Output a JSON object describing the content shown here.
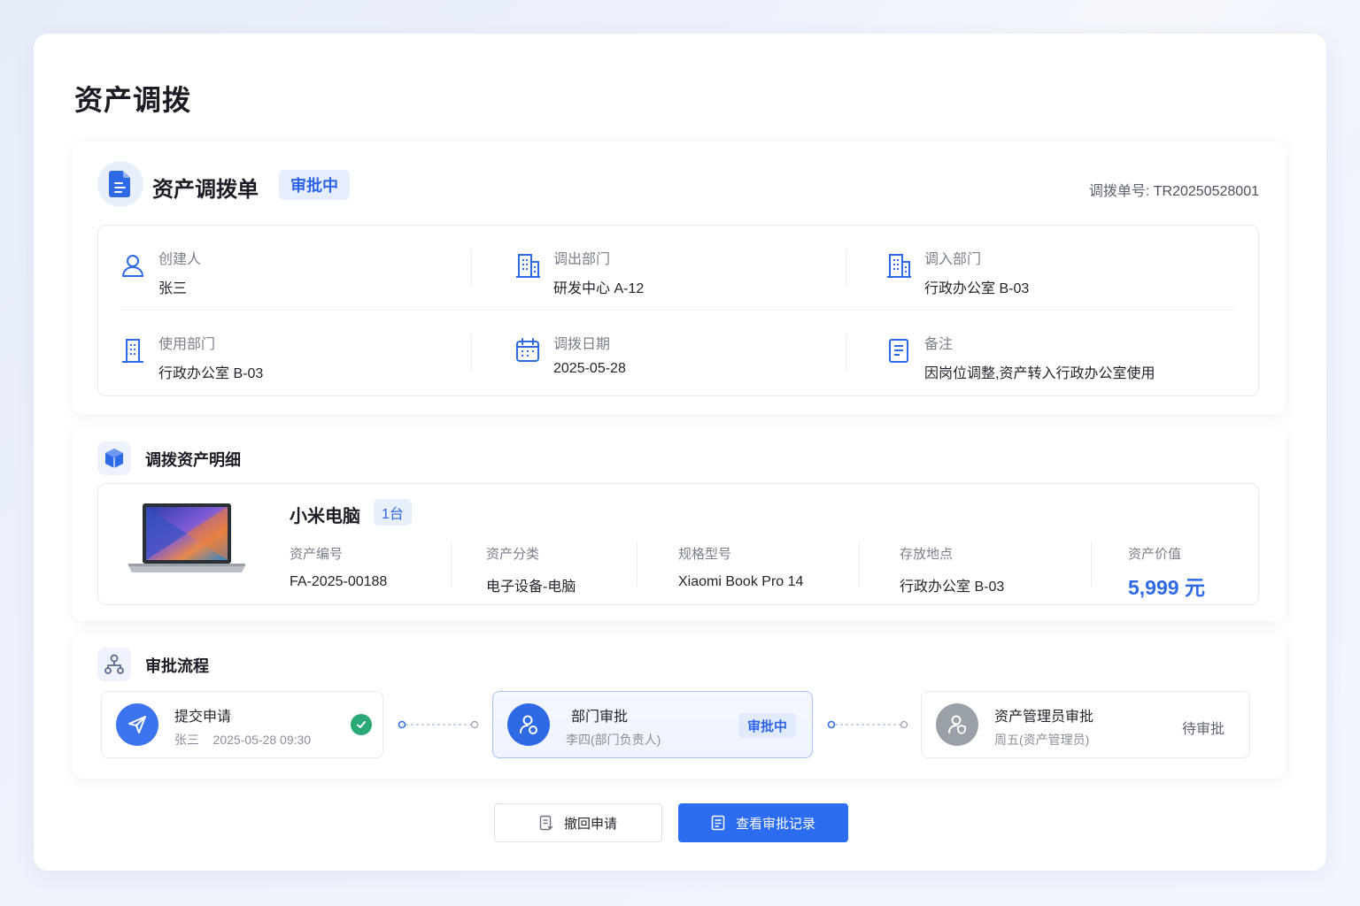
{
  "page": {
    "title": "资产调拨"
  },
  "form": {
    "title": "资产调拨单",
    "status": "审批中",
    "order_no_label": "调拨单号:",
    "order_no": "TR20250528001",
    "fields": [
      {
        "label": "创建人",
        "value": "张三",
        "icon": "user-icon"
      },
      {
        "label": "调出部门",
        "value": "研发中心 A-12",
        "icon": "building-icon"
      },
      {
        "label": "调入部门",
        "value": "行政办公室 B-03",
        "icon": "building-icon"
      },
      {
        "label": "使用部门",
        "value": "行政办公室 B-03",
        "icon": "building-icon"
      },
      {
        "label": "调拨日期",
        "value": "2025-05-28",
        "icon": "calendar-icon"
      },
      {
        "label": "备注",
        "value": "因岗位调整,资产转入行政办公室使用",
        "icon": "note-icon"
      }
    ]
  },
  "assets": {
    "title": "调拨资产明细",
    "items": [
      {
        "name": "小米电脑",
        "qty": "1台",
        "fields": [
          {
            "label": "资产编号",
            "value": "FA-2025-00188"
          },
          {
            "label": "资产分类",
            "value": "电子设备-电脑"
          },
          {
            "label": "规格型号",
            "value": "Xiaomi Book Pro 14"
          },
          {
            "label": "存放地点",
            "value": "行政办公室 B-03"
          },
          {
            "label": "资产价值",
            "value": "5,999 元"
          }
        ]
      }
    ]
  },
  "flow": {
    "title": "审批流程",
    "steps": [
      {
        "title": "提交申请",
        "sub": "张三    2025-05-28 09:30",
        "status": "completed"
      },
      {
        "title": "部门审批",
        "sub": "李四(部门负责人)",
        "status": "审批中"
      },
      {
        "title": "资产管理员审批",
        "sub": "周五(资产管理员)",
        "status": "待审批"
      }
    ]
  },
  "actions": {
    "withdraw": "撤回申请",
    "view_records": "查看审批记录"
  },
  "colors": {
    "primary": "#2b6cf0",
    "success": "#2aa876",
    "pending": "#9aa0a8"
  }
}
